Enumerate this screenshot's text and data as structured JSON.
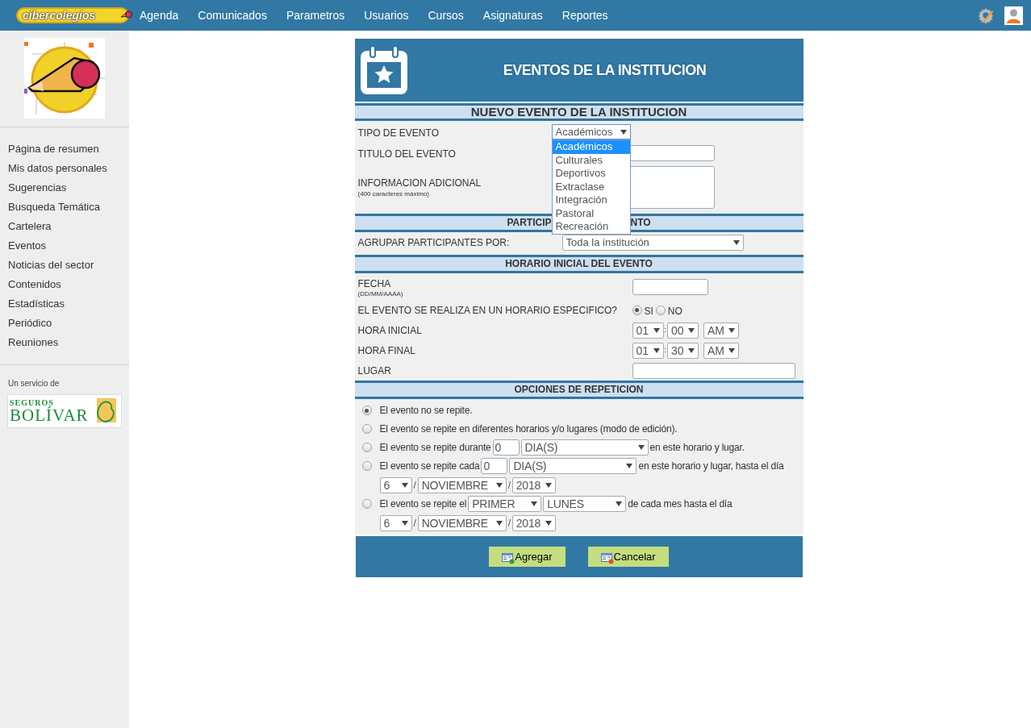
{
  "brand": {
    "logo_text": "cibercolegios"
  },
  "nav": [
    {
      "label": "Agenda"
    },
    {
      "label": "Comunicados"
    },
    {
      "label": "Parametros"
    },
    {
      "label": "Usuarios"
    },
    {
      "label": "Cursos"
    },
    {
      "label": "Asignaturas"
    },
    {
      "label": "Reportes"
    }
  ],
  "sidebar": {
    "menu": [
      {
        "label": "Página de resumen"
      },
      {
        "label": "Mis datos personales"
      },
      {
        "label": "Sugerencias"
      },
      {
        "label": "Busqueda Temática"
      },
      {
        "label": "Cartelera"
      },
      {
        "label": "Eventos"
      },
      {
        "label": "Noticias del sector"
      },
      {
        "label": "Contenidos"
      },
      {
        "label": "Estadísticas"
      },
      {
        "label": "Periódico"
      },
      {
        "label": "Reuniones"
      }
    ],
    "footer_label": "Un servicio de",
    "partner": {
      "line1": "SEGUROS",
      "line2": "BOLÍVAR"
    }
  },
  "panel": {
    "title": "EVENTOS DE LA INSTITUCION",
    "form_title": "NUEVO EVENTO DE LA INSTITUCION",
    "tipo": {
      "label": "TIPO DE EVENTO",
      "value": "Académicos",
      "expanded": true,
      "options": [
        {
          "label": "Académicos",
          "selected": true
        },
        {
          "label": "Culturales",
          "selected": false
        },
        {
          "label": "Deportivos",
          "selected": false
        },
        {
          "label": "Extraclase",
          "selected": false
        },
        {
          "label": "Integración",
          "selected": false
        },
        {
          "label": "Pastoral",
          "selected": false
        },
        {
          "label": "Recreación",
          "selected": false
        }
      ]
    },
    "titulo": {
      "label": "TITULO DEL EVENTO"
    },
    "info": {
      "label": "INFORMACION ADICIONAL",
      "hint": "(400 caracteres máximo)"
    },
    "participants_header": {
      "left": "PARTICIP",
      "right": "NTO"
    },
    "agrupar": {
      "label": "AGRUPAR PARTICIPANTES POR:",
      "value": "Toda la institución"
    },
    "horario_header": "HORARIO INICIAL DEL EVENTO",
    "fecha": {
      "label": "FECHA",
      "hint": "(DD/MM/AAAA)"
    },
    "especifico": {
      "label": "EL EVENTO SE REALIZA EN UN HORARIO ESPECIFICO?",
      "options": [
        {
          "label": "SI",
          "selected": true
        },
        {
          "label": "NO",
          "selected": false
        }
      ]
    },
    "times": [
      {
        "label": "HORA INICIAL",
        "hour": "01",
        "separator": ":",
        "minute": "00",
        "ampm": "AM"
      },
      {
        "label": "HORA FINAL",
        "hour": "01",
        "separator": ":",
        "minute": "30",
        "ampm": "AM"
      }
    ],
    "lugar": {
      "label": "LUGAR"
    },
    "repeat_header": "OPCIONES DE REPETICION",
    "repeat_options": [
      {
        "selected": true,
        "parts": [
          {
            "kind": "text",
            "text": "El evento no se repite."
          }
        ]
      },
      {
        "selected": false,
        "parts": [
          {
            "kind": "text",
            "text": "El evento se repite en diferentes horarios y/o lugares (modo de edición)."
          }
        ]
      },
      {
        "selected": false,
        "parts": [
          {
            "kind": "text",
            "text": "El evento se repite durante"
          },
          {
            "kind": "input",
            "text": "0"
          },
          {
            "kind": "unit",
            "text": "DIA(S)"
          },
          {
            "kind": "text",
            "text": "en este horario y lugar."
          }
        ]
      },
      {
        "selected": false,
        "parts": [
          {
            "kind": "text",
            "text": "El evento se repite cada"
          },
          {
            "kind": "input",
            "text": "0"
          },
          {
            "kind": "unit",
            "text": "DIA(S)"
          },
          {
            "kind": "text",
            "text": "en este horario y lugar, hasta el día"
          },
          {
            "kind": "break"
          },
          {
            "kind": "day",
            "text": "6"
          },
          {
            "kind": "sep",
            "text": "/"
          },
          {
            "kind": "month",
            "text": "NOVIEMBRE"
          },
          {
            "kind": "sep",
            "text": "/"
          },
          {
            "kind": "year",
            "text": "2018"
          }
        ]
      },
      {
        "selected": false,
        "parts": [
          {
            "kind": "text",
            "text": "El evento se repite el"
          },
          {
            "kind": "ordinal",
            "text": "PRIMER"
          },
          {
            "kind": "weekday",
            "text": "LUNES"
          },
          {
            "kind": "text",
            "text": "de cada mes hasta el día"
          },
          {
            "kind": "break"
          },
          {
            "kind": "day",
            "text": "6"
          },
          {
            "kind": "sep",
            "text": "/"
          },
          {
            "kind": "month",
            "text": "NOVIEMBRE"
          },
          {
            "kind": "sep",
            "text": "/"
          },
          {
            "kind": "year",
            "text": "2018"
          }
        ]
      }
    ],
    "buttons": [
      {
        "label": "Agregar",
        "kind": "add"
      },
      {
        "label": "Cancelar",
        "kind": "cancel"
      }
    ]
  }
}
